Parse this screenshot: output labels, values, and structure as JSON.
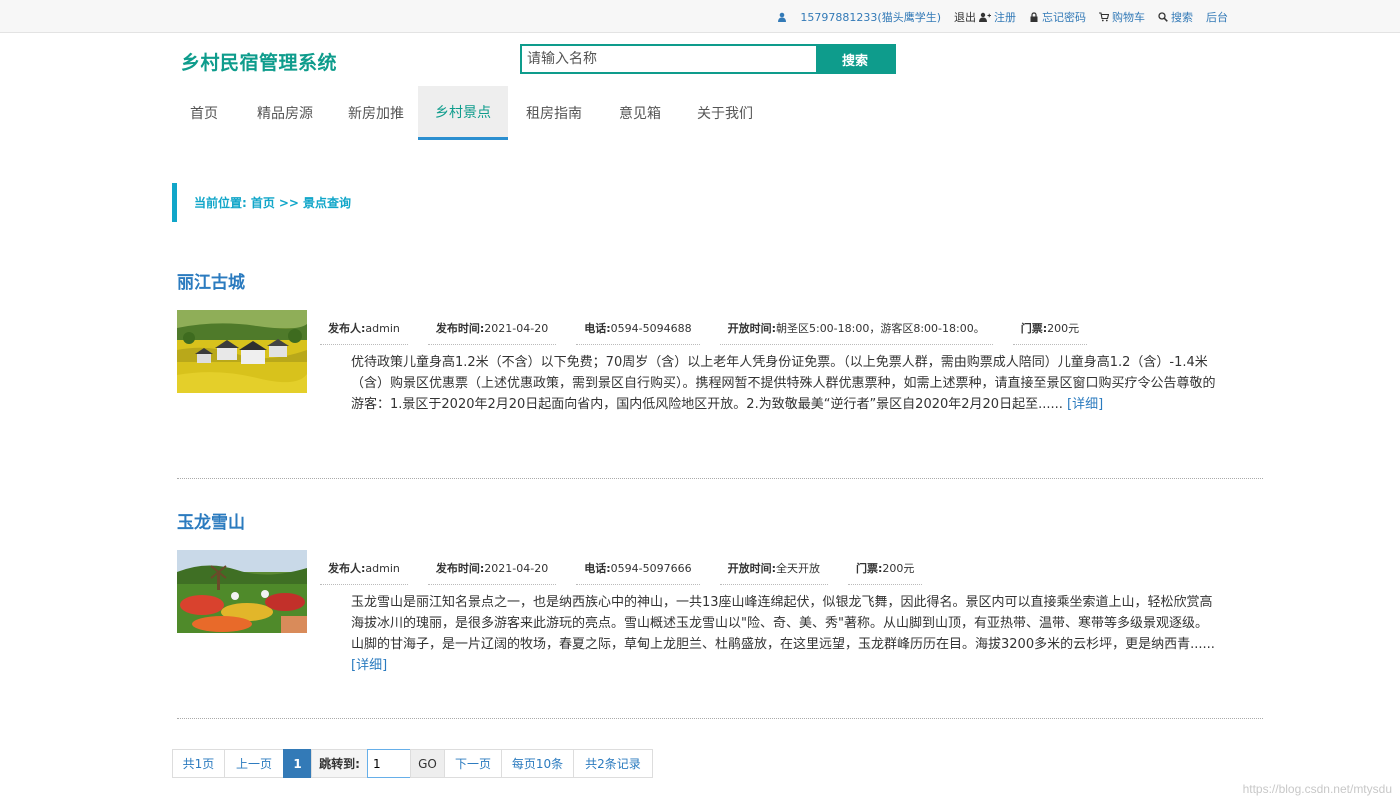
{
  "topbar": {
    "user": "15797881233(猫头鹰学生)",
    "logout": "退出",
    "register": "注册",
    "forgot": "忘记密码",
    "cart": "购物车",
    "search": "搜索",
    "admin": "后台"
  },
  "header": {
    "logo": "乡村民宿管理系统",
    "search_placeholder": "请输入名称",
    "search_button": "搜索"
  },
  "nav": [
    "首页",
    "精品房源",
    "新房加推",
    "乡村景点",
    "租房指南",
    "意见箱",
    "关于我们"
  ],
  "nav_active": "乡村景点",
  "breadcrumb": {
    "label": "当前位置:",
    "home": "首页",
    "sep": ">>",
    "current": "景点查询"
  },
  "labels": {
    "publisher": "发布人:",
    "time": "发布时间:",
    "phone": "电话:",
    "open": "开放时间:",
    "ticket": "门票:",
    "more": "[详细]"
  },
  "items": [
    {
      "title": "丽江古城",
      "publisher": "admin",
      "time": "2021-04-20",
      "phone": " 0594-5094688",
      "open": "朝圣区5:00-18:00，游客区8:00-18:00。",
      "ticket": "200元",
      "desc": "优待政策儿童身高1.2米（不含）以下免费；70周岁（含）以上老年人凭身份证免票。（以上免票人群，需由购票成人陪同）儿童身高1.2（含）-1.4米（含）购景区优惠票（上述优惠政策，需到景区自行购买）。携程网暂不提供特殊人群优惠票种，如需上述票种，请直接至景区窗口购买疗令公告尊敬的游客：1.景区于2020年2月20日起面向省内，国内低风险地区开放。2.为致敬最美“逆行者”景区自2020年2月20日起至......"
    },
    {
      "title": "玉龙雪山",
      "publisher": "admin",
      "time": "2021-04-20",
      "phone": "0594-5097666",
      "open": "全天开放",
      "ticket": "200元",
      "desc": "玉龙雪山是丽江知名景点之一，也是纳西族心中的神山，一共13座山峰连绵起伏，似银龙飞舞，因此得名。景区内可以直接乘坐索道上山，轻松欣赏高海拔冰川的瑰丽，是很多游客来此游玩的亮点。雪山概述玉龙雪山以\"险、奇、美、秀\"著称。从山脚到山顶，有亚热带、温带、寒带等多级景观逐级。山脚的甘海子，是一片辽阔的牧场，春夏之际，草甸上龙胆兰、杜鹃盛放，在这里远望，玉龙群峰历历在目。海拔3200多米的云杉坪，更是纳西青......"
    }
  ],
  "pager": {
    "total_pages": "共1页",
    "prev": "上一页",
    "current": "1",
    "jump_label": "跳转到:",
    "jump_value": "1",
    "go": "GO",
    "next": "下一页",
    "per_page": "每页10条",
    "total_records": "共2条记录"
  },
  "watermark": "https://blog.csdn.net/mtysdu",
  "colors": {
    "brand": "#0e9c8c",
    "link": "#2b7bbf",
    "breadcrumb": "#11a6c9",
    "pager_active": "#337ab7"
  }
}
